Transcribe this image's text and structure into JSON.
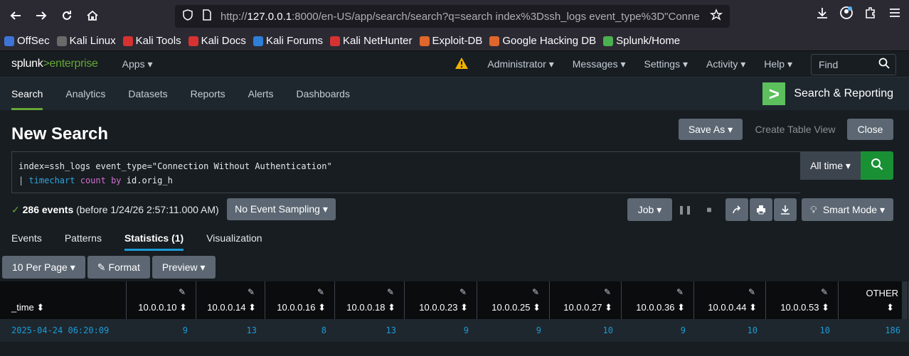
{
  "browser": {
    "url_prefix": "http://",
    "url_host": "127.0.0.1",
    "url_rest": ":8000/en-US/app/search/search?q=search index%3Dssh_logs event_type%3D\"Conne",
    "bookmarks": [
      {
        "label": "OffSec",
        "color": "#3e74d8"
      },
      {
        "label": "Kali Linux",
        "color": "#6a6a6a"
      },
      {
        "label": "Kali Tools",
        "color": "#d63232"
      },
      {
        "label": "Kali Docs",
        "color": "#d63232"
      },
      {
        "label": "Kali Forums",
        "color": "#2f7ed8"
      },
      {
        "label": "Kali NetHunter",
        "color": "#d63232"
      },
      {
        "label": "Exploit-DB",
        "color": "#e0662c"
      },
      {
        "label": "Google Hacking DB",
        "color": "#e0662c"
      },
      {
        "label": "Splunk/Home",
        "color": "#4caf50"
      }
    ]
  },
  "splunk": {
    "logo_main": "splunk",
    "logo_sub": "enterprise",
    "apps": "Apps ▾",
    "menu": [
      "Administrator ▾",
      "Messages ▾",
      "Settings ▾",
      "Activity ▾",
      "Help ▾"
    ],
    "find_placeholder": "Find"
  },
  "app_nav": {
    "tabs": [
      "Search",
      "Analytics",
      "Datasets",
      "Reports",
      "Alerts",
      "Dashboards"
    ],
    "app_name": "Search & Reporting"
  },
  "search": {
    "page_title": "New Search",
    "save_as": "Save As ▾",
    "create_table": "Create Table View",
    "close": "Close",
    "line1": "index=ssh_logs event_type=\"Connection Without Authentication\"",
    "pipe": "| ",
    "cmd": "timechart",
    "fn": "count",
    "by": "by",
    "field": "id.orig_h",
    "time_range": "All time ▾"
  },
  "status": {
    "events": "286 events",
    "detail": "(before 1/24/26 2:57:11.000 AM)",
    "sampling": "No Event Sampling ▾",
    "job": "Job ▾",
    "mode": "Smart Mode ▾"
  },
  "result_tabs": [
    "Events",
    "Patterns",
    "Statistics (1)",
    "Visualization"
  ],
  "table_buttons": [
    "10 Per Page ▾",
    "Format",
    "Preview ▾"
  ],
  "table": {
    "columns": [
      "_time ⬍",
      "10.0.0.10 ⬍",
      "10.0.0.14 ⬍",
      "10.0.0.16 ⬍",
      "10.0.0.18 ⬍",
      "10.0.0.23 ⬍",
      "10.0.0.25 ⬍",
      "10.0.0.27 ⬍",
      "10.0.0.36 ⬍",
      "10.0.0.44 ⬍",
      "10.0.0.53 ⬍",
      "OTHER"
    ],
    "row": [
      "2025-04-24 06:20:09",
      "9",
      "13",
      "8",
      "13",
      "9",
      "9",
      "10",
      "9",
      "10",
      "10",
      "186"
    ]
  }
}
